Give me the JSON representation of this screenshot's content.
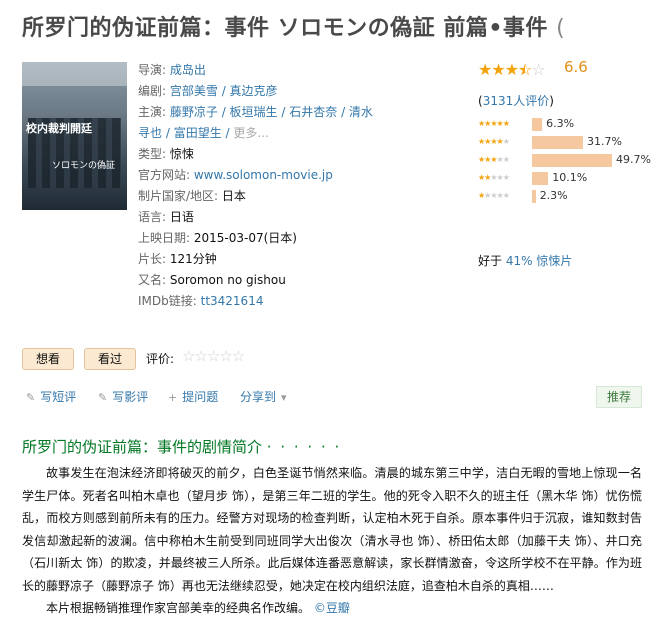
{
  "title": "所罗门的伪证前篇：事件 ソロモンの偽証 前篇•事件",
  "title_paren": "(",
  "poster": {
    "headline": "校内裁判開廷",
    "subtitle": "ソロモンの偽証",
    "alt": "poster"
  },
  "info": {
    "director_label": "导演: ",
    "director": "成岛出",
    "writer_label": "编剧: ",
    "writers": [
      "宫部美雪",
      "真边克彦"
    ],
    "cast_label": "主演: ",
    "cast_line1": [
      "藤野凉子",
      "板垣瑞生",
      "石井杏奈",
      "清水"
    ],
    "cast_line2": [
      "寻也",
      "富田望生"
    ],
    "cast_more": "更多...",
    "genre_label": "类型: ",
    "genre": "惊悚",
    "site_label": "官方网站: ",
    "site": "www.solomon-movie.jp",
    "country_label": "制片国家/地区: ",
    "country": "日本",
    "language_label": "语言: ",
    "language": "日语",
    "release_label": "上映日期: ",
    "release": "2015-03-07(日本)",
    "runtime_label": "片长: ",
    "runtime": "121分钟",
    "aka_label": "又名: ",
    "aka": "Soromon no gishou",
    "imdb_label": "IMDb链接: ",
    "imdb": "tt3421614"
  },
  "rating": {
    "score": "6.6",
    "stars_filled": 3.5,
    "votes_open": "(",
    "votes_link": "3131人评价",
    "votes_close": ")",
    "distribution": [
      {
        "stars": 5,
        "percent": 6.3,
        "label": "6.3%"
      },
      {
        "stars": 4,
        "percent": 31.7,
        "label": "31.7%"
      },
      {
        "stars": 3,
        "percent": 49.7,
        "label": "49.7%"
      },
      {
        "stars": 2,
        "percent": 10.1,
        "label": "10.1%"
      },
      {
        "stars": 1,
        "percent": 2.3,
        "label": "2.3%"
      }
    ],
    "better_prefix": "好于 ",
    "better_value": "41% 惊悚片"
  },
  "actions": {
    "want": "想看",
    "seen": "看过",
    "rate_label": "评价:",
    "short_review": "写短评",
    "review": "写影评",
    "question": "提问题",
    "share": "分享到",
    "recommend": "推荐"
  },
  "synopsis": {
    "heading": "所罗门的伪证前篇：事件的剧情简介",
    "heading_dots": "· · · · · ·",
    "p1": "故事发生在泡沫经济即将破灭的前夕，白色圣诞节悄然来临。清晨的城东第三中学，洁白无暇的雪地上惊现一名学生尸体。死者名叫柏木卓也（望月步 饰），是第三年二班的学生。他的死令入职不久的班主任（黑木华 饰）忧伤慌乱，而校方则感到前所未有的压力。经警方对现场的检查判断，认定柏木死于自杀。原本事件归于沉寂，谁知数封告发信却激起新的波澜。信中称柏木生前受到同班同学大出俊次（清水寻也 饰）、桥田佑太郎（加藤干夫 饰）、井口充（石川新太 饰）的欺凌，并最终被三人所杀。此后媒体连番恶意解读，家长群情激奋，令这所学校不在平静。作为班长的藤野凉子（藤野凉子 饰）再也无法继续忍受，她决定在校内组织法庭，追查柏木自杀的真相……",
    "p2": "本片根据畅销推理作家宫部美幸的经典名作改编。",
    "source": "©豆瓣"
  },
  "colors": {
    "accent": "#3377aa",
    "star": "#f4a30c",
    "bar": "#f6c89f",
    "heading": "#007722"
  }
}
